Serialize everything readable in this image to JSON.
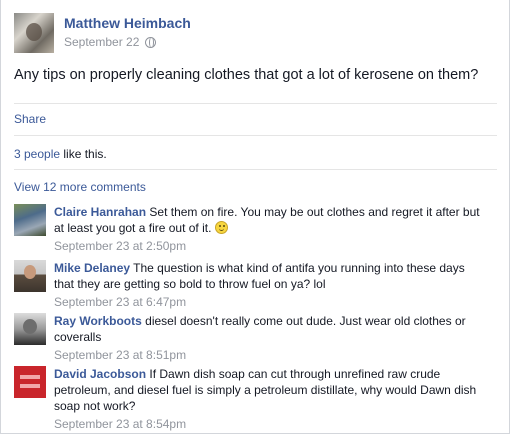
{
  "post": {
    "author": "Matthew Heimbach",
    "date": "September 22",
    "text": "Any tips on properly cleaning clothes that got a lot of kerosene on them?",
    "share_label": "Share",
    "likes_count_link": "3 people",
    "likes_suffix": " like this.",
    "view_more_label": "View 12 more comments"
  },
  "comments": [
    {
      "author": "Claire Hanrahan",
      "text": "Set them on fire. You may be out clothes and regret it after but at least you got a fire out of it.",
      "time": "September 23 at 2:50pm",
      "has_emoji": true
    },
    {
      "author": "Mike Delaney",
      "text": "The question is what kind of antifa you running into these days that they are getting so bold to throw fuel on ya? lol",
      "time": "September 23 at 6:47pm"
    },
    {
      "author": "Ray Workboots",
      "text": "diesel doesn't really come out dude. Just wear old clothes or coveralls",
      "time": "September 23 at 8:51pm"
    },
    {
      "author": "David Jacobson",
      "text": "If Dawn dish soap can cut through unrefined raw crude petroleum, and diesel fuel is simply a petroleum distillate, why would Dawn dish soap not work?",
      "time": "September 23 at 8:54pm"
    }
  ],
  "icons": {
    "privacy": "globe-icon",
    "emoji": "smiley-emoji-icon"
  }
}
